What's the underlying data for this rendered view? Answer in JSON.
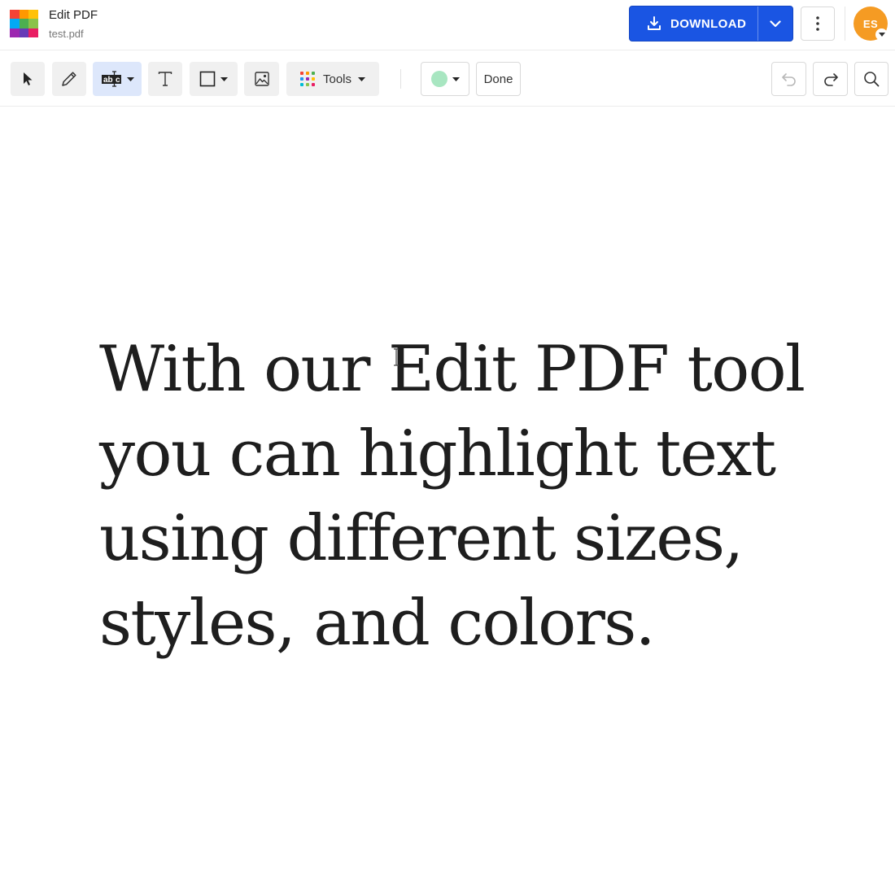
{
  "app": {
    "title": "Edit PDF",
    "file_name": "test.pdf",
    "logo_colors": [
      "#f44336",
      "#ff9800",
      "#ffc107",
      "#03a9f4",
      "#4caf50",
      "#8bc34a",
      "#9c27b0",
      "#673ab7",
      "#e91e63"
    ]
  },
  "header": {
    "download_label": "DOWNLOAD",
    "download_color": "#1a55e3",
    "avatar_initials": "ES",
    "avatar_color": "#f59b23"
  },
  "toolbar": {
    "tools_label": "Tools",
    "done_label": "Done",
    "highlight_swatch_color": "#a8e6c1",
    "tools_grid_colors": [
      "#f44336",
      "#ff9800",
      "#4caf50",
      "#2196f3",
      "#9c27b0",
      "#ffc107",
      "#00bcd4",
      "#8bc34a",
      "#e91e63"
    ]
  },
  "document": {
    "lines": [
      "With our Edit PDF tool",
      "you can highlight text",
      "using different sizes,",
      "styles, and colors."
    ]
  }
}
